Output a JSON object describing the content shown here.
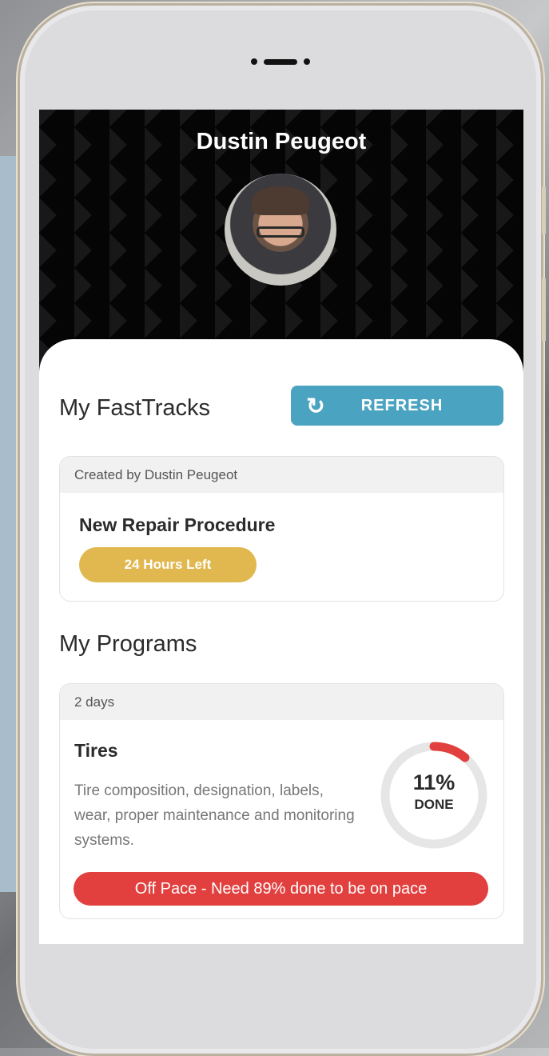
{
  "profile": {
    "name": "Dustin Peugeot"
  },
  "fasttracks": {
    "title": "My FastTracks",
    "refresh_label": "REFRESH",
    "refresh_icon": "refresh-icon",
    "items": [
      {
        "created_by": "Created by Dustin Peugeot",
        "title": "New Repair Procedure",
        "time_left": "24 Hours Left"
      }
    ]
  },
  "programs": {
    "title": "My Programs",
    "items": [
      {
        "duration": "2 days",
        "title": "Tires",
        "description": "Tire composition, designation, labels, wear, proper maintenance and monitoring systems.",
        "progress_percent": 11,
        "progress_label": "11%",
        "done_label": "DONE",
        "pace_status": "Off Pace - Need 89% done to be on pace"
      }
    ]
  },
  "colors": {
    "refresh": "#4aa3c0",
    "time_pill": "#e0b84f",
    "pace_pill": "#e1403e",
    "progress": "#e1403e",
    "ring_track": "#e6e6e6"
  }
}
